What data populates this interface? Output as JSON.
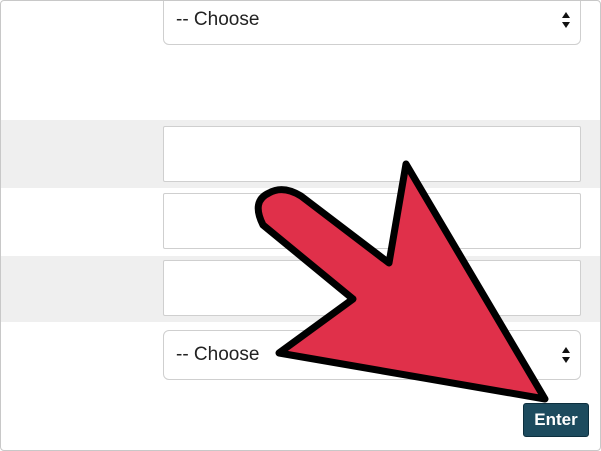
{
  "form": {
    "top_select": {
      "value": "-- Choose"
    },
    "bottom_select": {
      "value": "-- Choose"
    },
    "text_input_1": {
      "value": ""
    },
    "text_input_2": {
      "value": ""
    },
    "text_input_3": {
      "value": ""
    },
    "enter_label": "Enter"
  },
  "colors": {
    "row_band": "#efefef",
    "enter_button": "#1d4b5e",
    "arrow_fill": "#e0304a",
    "arrow_outline": "#000000"
  },
  "overlay": {
    "icon": "pointer-arrow-icon"
  }
}
